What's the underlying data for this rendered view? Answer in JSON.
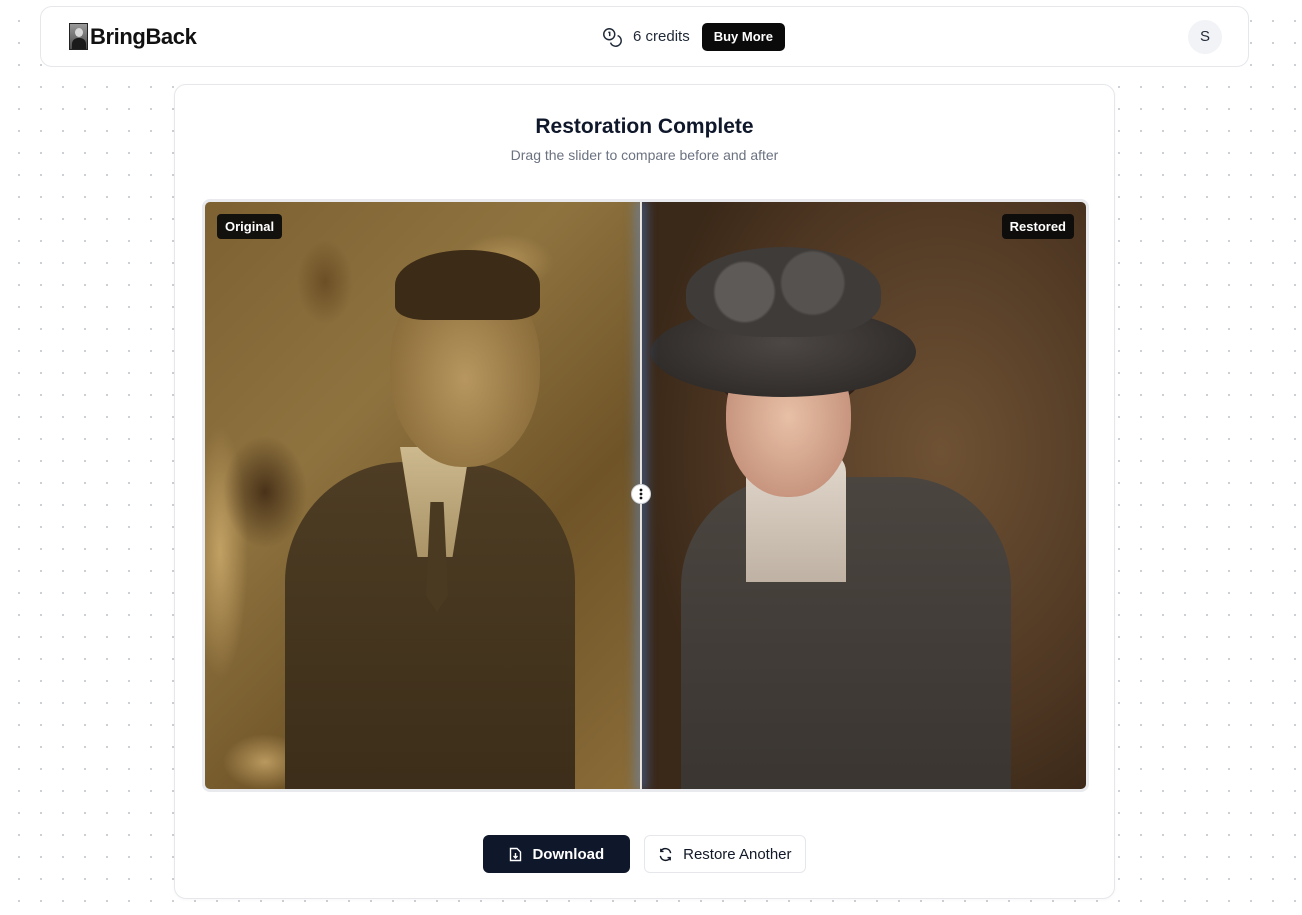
{
  "header": {
    "brand": "BringBack",
    "credits_label": "6 credits",
    "buy_label": "Buy More",
    "avatar_initial": "S"
  },
  "main": {
    "title": "Restoration Complete",
    "subtitle": "Drag the slider to compare before and after",
    "compare": {
      "original_label": "Original",
      "restored_label": "Restored",
      "slider_position": 0.49
    },
    "actions": {
      "download_label": "Download",
      "restore_another_label": "Restore Another"
    }
  },
  "colors": {
    "primary": "#0f172a",
    "buy_button": "#0a0a0a",
    "divider_glow": "#5096ff"
  },
  "icons": [
    "logo-icon",
    "coins-icon",
    "slider-handle-icon",
    "download-icon",
    "refresh-icon"
  ]
}
